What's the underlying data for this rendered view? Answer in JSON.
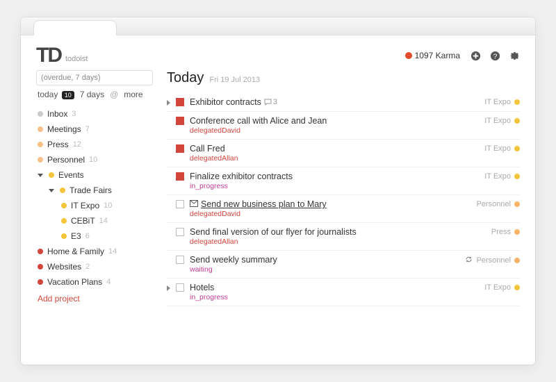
{
  "brand": {
    "mark": "TD",
    "word": "todoist"
  },
  "header": {
    "karma_value": "1097 Karma",
    "icons": {
      "add": "add-icon",
      "help": "help-icon",
      "settings": "gear-icon"
    }
  },
  "sidebar": {
    "search_value": "(overdue, 7 days)",
    "filters": {
      "today_label": "today",
      "today_badge": "10",
      "sevendays_label": "7 days",
      "more_label": "more"
    },
    "projects": [
      {
        "name": "Inbox",
        "count": "3",
        "color": "c-grey",
        "indent": 0
      },
      {
        "name": "Meetings",
        "count": "7",
        "color": "c-peach",
        "indent": 0
      },
      {
        "name": "Press",
        "count": "12",
        "color": "c-peach",
        "indent": 0
      },
      {
        "name": "Personnel",
        "count": "10",
        "color": "c-peach",
        "indent": 0
      },
      {
        "name": "Events",
        "count": "",
        "color": "c-yellow",
        "indent": 0,
        "expanded": true
      },
      {
        "name": "Trade Fairs",
        "count": "",
        "color": "c-yellow",
        "indent": 1,
        "expanded": true
      },
      {
        "name": "IT Expo",
        "count": "10",
        "color": "c-yellow",
        "indent": 2
      },
      {
        "name": "CEBiT",
        "count": "14",
        "color": "c-yellow",
        "indent": 2
      },
      {
        "name": "E3",
        "count": "6",
        "color": "c-yellow",
        "indent": 2
      },
      {
        "name": "Home & Family",
        "count": "14",
        "color": "c-red",
        "indent": 0
      },
      {
        "name": "Websites",
        "count": "2",
        "color": "c-red",
        "indent": 0
      },
      {
        "name": "Vacation Plans",
        "count": "4",
        "color": "c-red",
        "indent": 0
      }
    ],
    "add_project_label": "Add project"
  },
  "main": {
    "title": "Today",
    "date": "Fri 19 Jul 2013",
    "tasks": [
      {
        "title": "Exhibitor contracts",
        "priority": "p1",
        "comments": "3",
        "project": "IT Expo",
        "proj_color": "c-yellow",
        "has_sub": true
      },
      {
        "title": "Conference call with Alice and Jean",
        "priority": "p1",
        "sub_kind": "delegated",
        "sub_text": "delegatedDavid",
        "project": "IT Expo",
        "proj_color": "c-yellow"
      },
      {
        "title": "Call Fred",
        "priority": "p1",
        "sub_kind": "delegated",
        "sub_text": "delegatedAllan",
        "project": "IT Expo",
        "proj_color": "c-yellow"
      },
      {
        "title": "Finalize exhibitor contracts",
        "priority": "p1",
        "sub_kind": "state",
        "sub_text": "in_progress",
        "project": "IT Expo",
        "proj_color": "c-yellow"
      },
      {
        "title": "Send new business plan to Mary",
        "priority": "",
        "mail": true,
        "underline": true,
        "sub_kind": "delegated",
        "sub_text": "delegatedDavid",
        "project": "Personnel",
        "proj_color": "c-lorange"
      },
      {
        "title": "Send final version of our flyer for journalists",
        "priority": "",
        "sub_kind": "delegated",
        "sub_text": "delegatedAllan",
        "project": "Press",
        "proj_color": "c-lorange"
      },
      {
        "title": "Send weekly summary",
        "priority": "",
        "sub_kind": "state",
        "sub_text": "waiting",
        "recurring": true,
        "project": "Personnel",
        "proj_color": "c-lorange"
      },
      {
        "title": "Hotels",
        "priority": "",
        "sub_kind": "state",
        "sub_text": "in_progress",
        "project": "IT Expo",
        "proj_color": "c-yellow",
        "has_sub": true
      }
    ]
  }
}
